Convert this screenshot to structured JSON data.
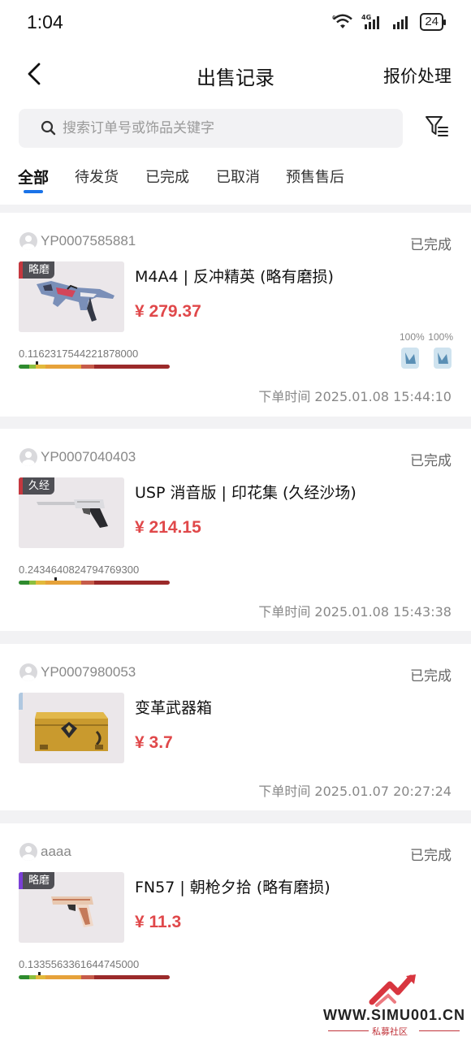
{
  "status_bar": {
    "time": "1:04",
    "network": "4G",
    "wifi_tag": "6",
    "battery": "24"
  },
  "nav": {
    "title": "出售记录",
    "action": "报价处理"
  },
  "search": {
    "placeholder": "搜索订单号或饰品关键字",
    "value": ""
  },
  "tabs": [
    {
      "label": "全部",
      "active": true
    },
    {
      "label": "待发货",
      "active": false
    },
    {
      "label": "已完成",
      "active": false
    },
    {
      "label": "已取消",
      "active": false
    },
    {
      "label": "预售售后",
      "active": false
    }
  ],
  "orders": [
    {
      "order_id": "YP0007585881",
      "status": "已完成",
      "wear_tag": "略磨",
      "name": "M4A4 | 反冲精英 (略有磨损)",
      "price": "¥ 279.37",
      "float": "0.1162317544221878000",
      "float_fraction": 0.116,
      "stickers": [
        "100%",
        "100%"
      ],
      "time": "下单时间 2025.01.08 15:44:10"
    },
    {
      "order_id": "YP0007040403",
      "status": "已完成",
      "wear_tag": "久经",
      "name": "USP 消音版 | 印花集 (久经沙场)",
      "price": "¥ 214.15",
      "float": "0.2434640824794769300",
      "float_fraction": 0.243,
      "time": "下单时间 2025.01.08 15:43:38"
    },
    {
      "order_id": "YP0007980053",
      "status": "已完成",
      "name": "变革武器箱",
      "price": "¥ 3.7",
      "time": "下单时间 2025.01.07 20:27:24"
    },
    {
      "order_id": "aaaa",
      "status": "已完成",
      "wear_tag": "略磨",
      "name": "FN57 | 朝枪夕拾 (略有磨损)",
      "price": "¥ 11.3",
      "float": "0.1335563361644745000",
      "float_fraction": 0.134
    }
  ],
  "watermark": {
    "site": "WWW.SIMU001.CN",
    "sub": "私募社区"
  },
  "colors": {
    "accent": "#1a73e8",
    "price": "#e0484a"
  }
}
